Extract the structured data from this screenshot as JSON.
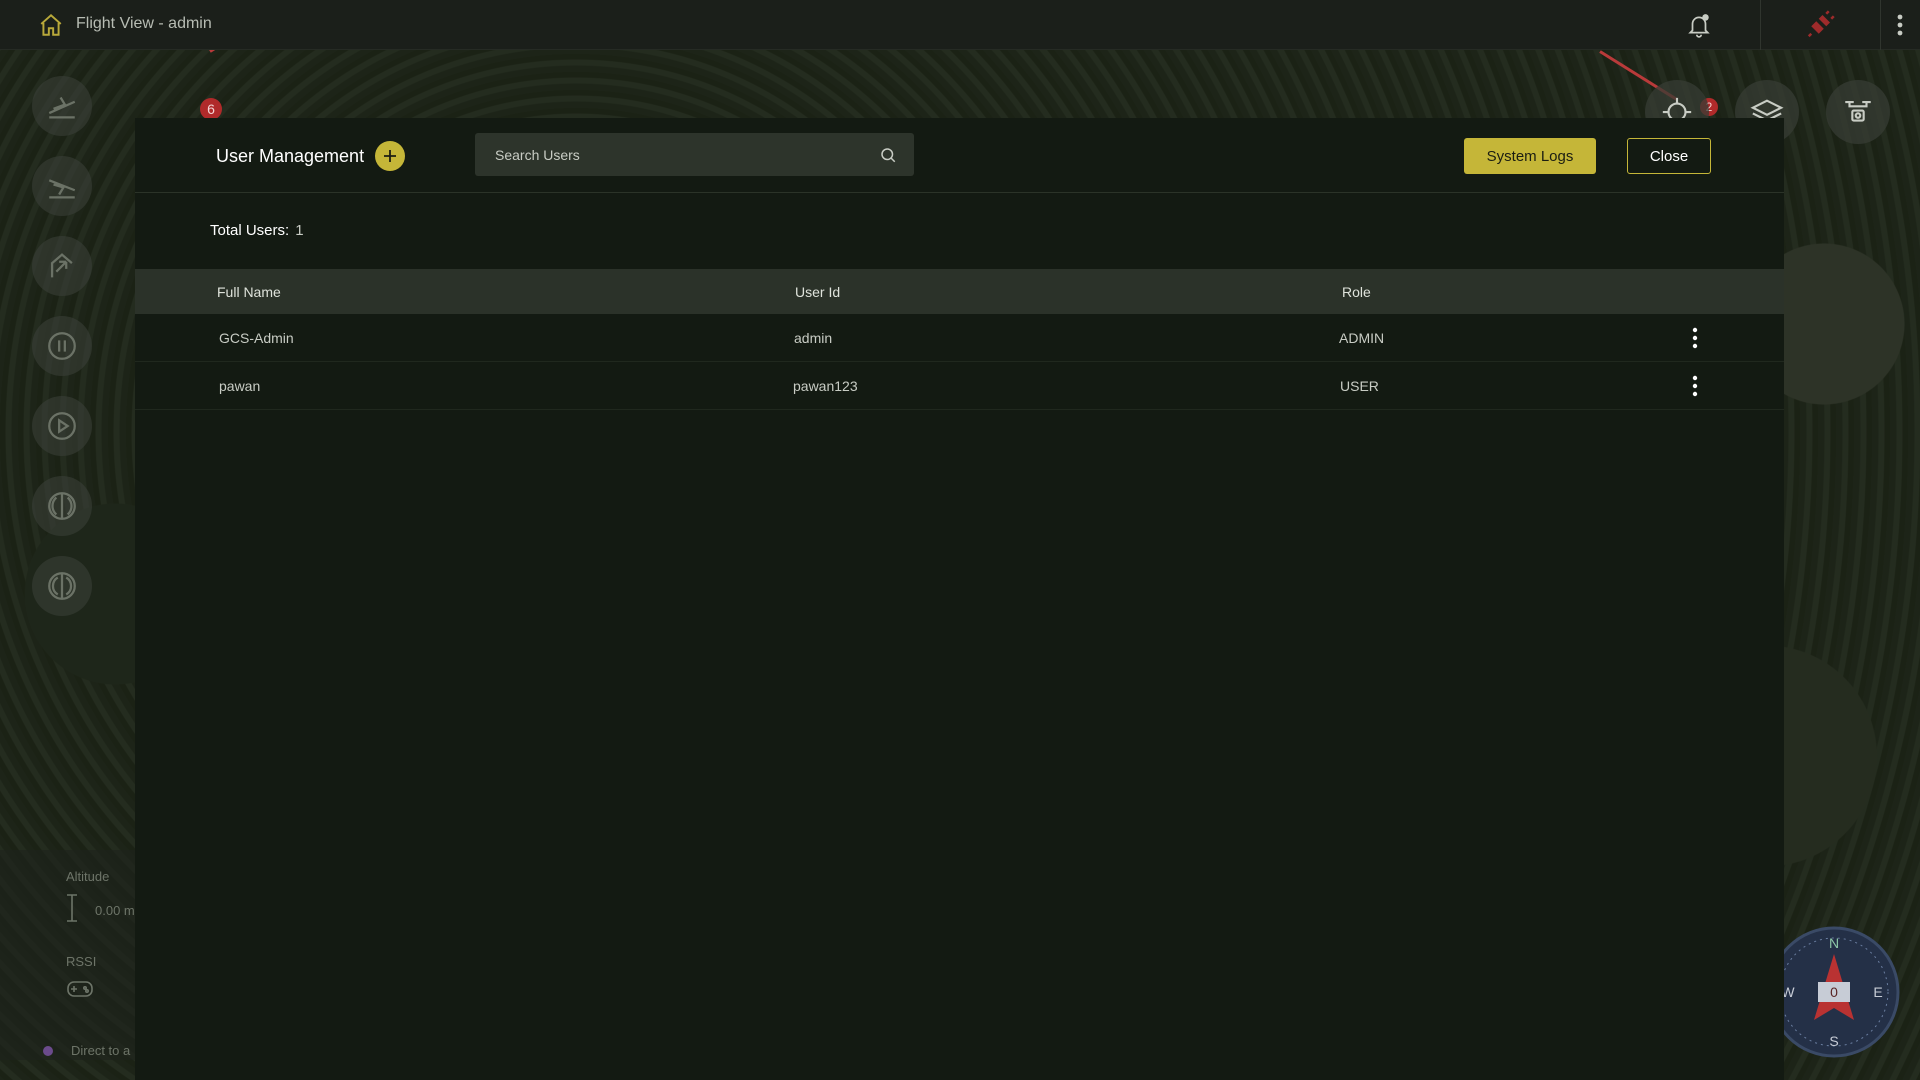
{
  "app": {
    "title": "Flight View - admin"
  },
  "map": {
    "waypoints": [
      "6",
      "2"
    ]
  },
  "telemetry": {
    "altitude_label": "Altitude",
    "altitude_value": "0.00 m",
    "rssi_label": "RSSI",
    "direct_label": "Direct to a"
  },
  "compass": {
    "north": "N",
    "east": "E",
    "south": "S",
    "west": "W",
    "heading": "0"
  },
  "modal": {
    "title": "User Management",
    "search_placeholder": "Search Users",
    "system_logs_label": "System Logs",
    "close_label": "Close",
    "total_users_label": "Total Users:",
    "total_users_value": "1",
    "columns": [
      "Full Name",
      "User Id",
      "Role"
    ],
    "rows": [
      {
        "full_name": "GCS-Admin",
        "user_id": "admin",
        "role": "ADMIN"
      },
      {
        "full_name": "pawan",
        "user_id": "pawan123",
        "role": "USER"
      }
    ]
  },
  "colors": {
    "accent": "#c5b638",
    "modal_bg": "#131a12",
    "table_header_bg": "#2b3229",
    "topbar_bg": "#1b1f1a",
    "waypoint": "#b02a2a"
  },
  "icons": [
    "home-icon",
    "bell-icon",
    "plug-icon",
    "more-vert-icon",
    "plus-icon",
    "search-icon",
    "takeoff-icon",
    "land-icon",
    "rtl-icon",
    "pause-icon",
    "play-icon",
    "layers-icon",
    "drone-camera-icon",
    "gps-target-icon"
  ]
}
